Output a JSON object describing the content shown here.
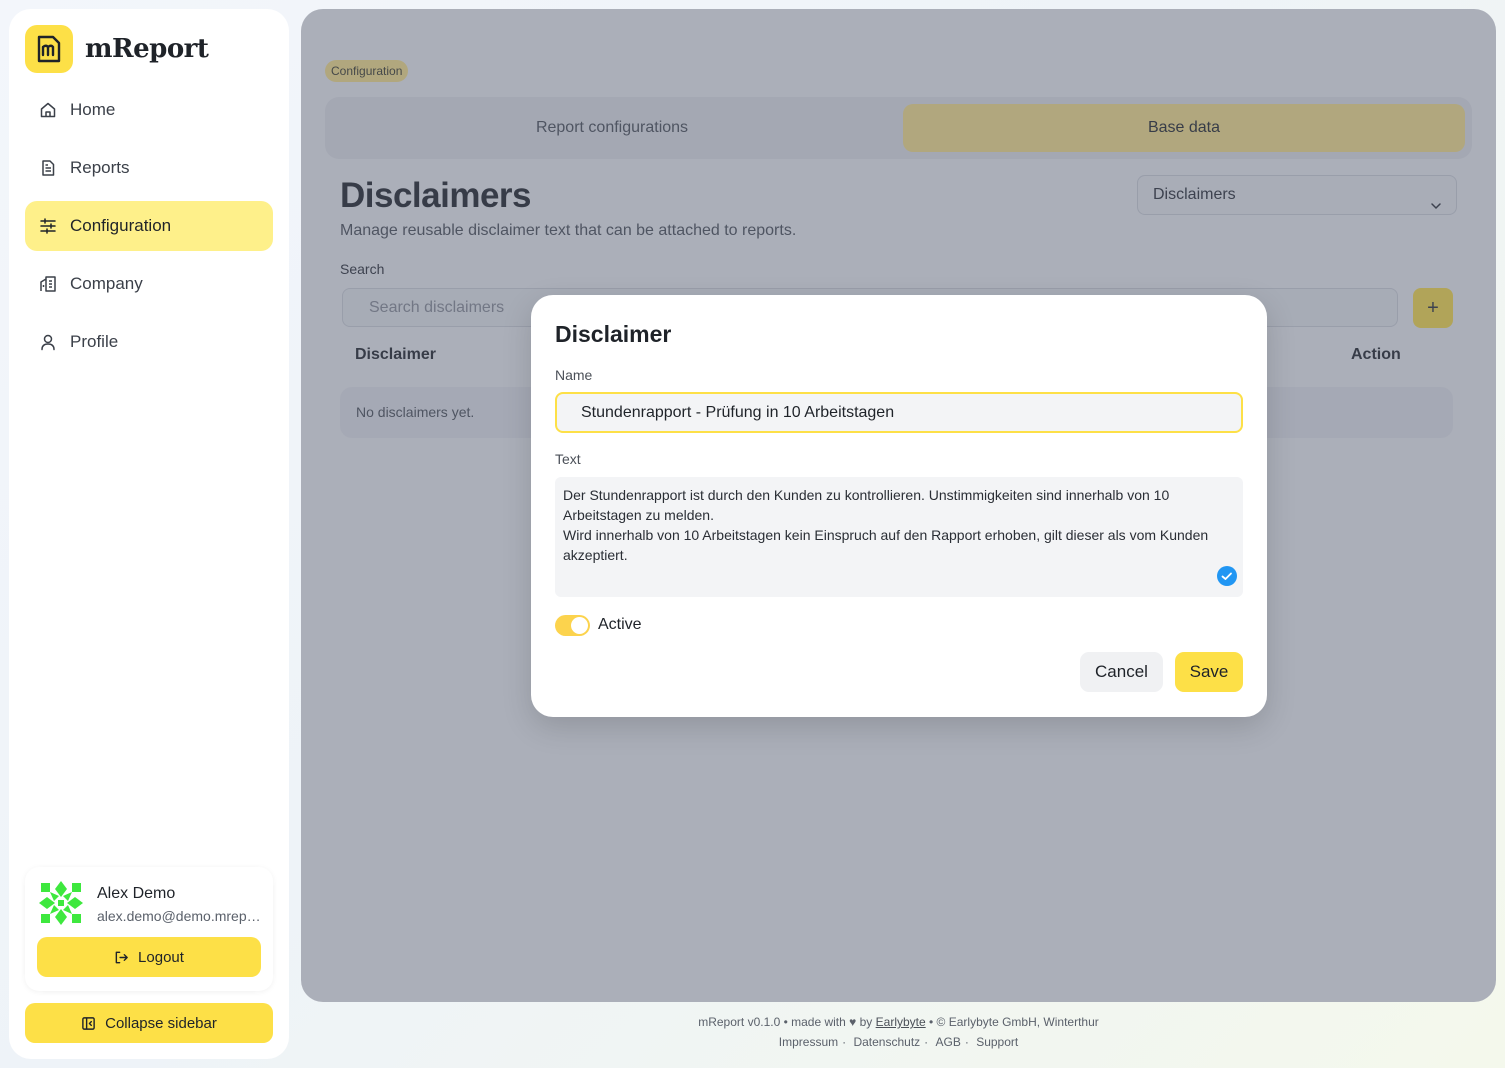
{
  "app": {
    "name": "mReport"
  },
  "sidebar": {
    "items": [
      {
        "label": "Home",
        "icon": "home-icon"
      },
      {
        "label": "Reports",
        "icon": "file-icon"
      },
      {
        "label": "Configuration",
        "icon": "sliders-icon",
        "active": true
      },
      {
        "label": "Company",
        "icon": "building-icon"
      },
      {
        "label": "Profile",
        "icon": "user-icon"
      }
    ],
    "user": {
      "name": "Alex Demo",
      "email": "alex.demo@demo.mreport.ch"
    },
    "logout_label": "Logout",
    "collapse_label": "Collapse sidebar"
  },
  "main": {
    "breadcrumb": "Configuration",
    "tabs": [
      {
        "label": "Report configurations"
      },
      {
        "label": "Base data",
        "active": true
      }
    ],
    "title": "Disclaimers",
    "subtitle": "Manage reusable disclaimer text that can be attached to reports.",
    "selector_value": "Disclaimers",
    "search_label": "Search",
    "search_placeholder": "Search disclaimers",
    "add_label": "+",
    "table": {
      "columns": [
        "Disclaimer",
        "Action"
      ],
      "empty_text": "No disclaimers yet."
    }
  },
  "modal": {
    "title": "Disclaimer",
    "name_label": "Name",
    "name_value": "Stundenrapport - Prüfung in 10 Arbeitstagen",
    "text_label": "Text",
    "text_lines": [
      "Der Stundenrapport ist durch den Kunden zu kontrollieren. Unstimmigkeiten sind innerhalb von 10",
      "Arbeitstagen zu melden.",
      "Wird innerhalb von 10 Arbeitstagen kein Einspruch auf den Rapport erhoben, gilt dieser als vom Kunden",
      "akzeptiert."
    ],
    "active_label": "Active",
    "active": true,
    "cancel_label": "Cancel",
    "save_label": "Save"
  },
  "footer": {
    "line1_prefix": "mReport v0.1.0 • made with ♥ by",
    "company_link": "Earlybyte",
    "line1_suffix": "• © Earlybyte GmbH, Winterthur",
    "links": [
      "Impressum",
      "Datenschutz",
      "AGB",
      "Support"
    ],
    "separator": "·"
  },
  "colors": {
    "accent": "#fde047",
    "accent_soft": "#fef08a",
    "info": "#2196f3"
  }
}
